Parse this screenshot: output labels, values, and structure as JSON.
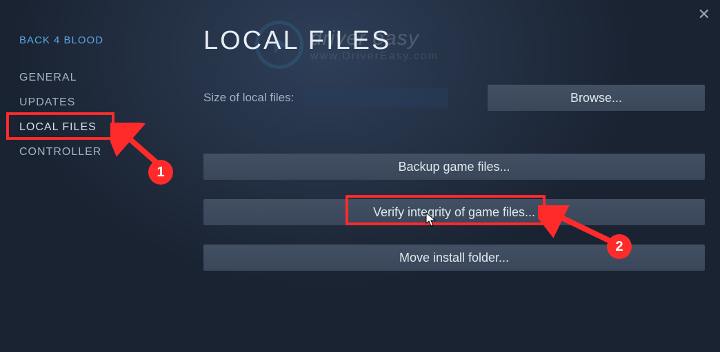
{
  "window": {
    "close_label": "✕"
  },
  "watermark": {
    "line1": "driver easy",
    "line2": "www.DriverEasy.com"
  },
  "sidebar": {
    "game_title": "BACK 4 BLOOD",
    "items": [
      {
        "label": "GENERAL"
      },
      {
        "label": "UPDATES"
      },
      {
        "label": "LOCAL FILES"
      },
      {
        "label": "CONTROLLER"
      }
    ]
  },
  "page": {
    "title": "LOCAL FILES",
    "size_label": "Size of local files:",
    "size_value": "",
    "browse_label": "Browse...",
    "buttons": [
      {
        "label": "Backup game files..."
      },
      {
        "label": "Verify integrity of game files..."
      },
      {
        "label": "Move install folder..."
      }
    ]
  },
  "annotations": {
    "step1": "1",
    "step2": "2"
  }
}
